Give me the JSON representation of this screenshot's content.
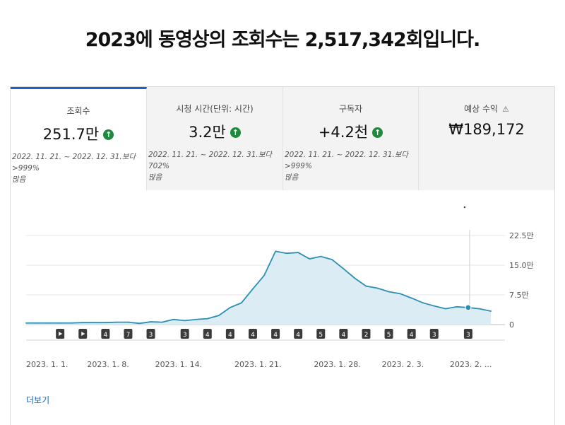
{
  "headline": "2023에 동영상의 조회수는 2,517,342회입니다.",
  "cards": [
    {
      "label": "조회수",
      "value": "251.7만",
      "trend": "up",
      "compare_line1": "2022. 11. 21. ~ 2022. 12. 31.보다 >999%",
      "compare_line2": "많음"
    },
    {
      "label": "시청 시간(단위: 시간)",
      "value": "3.2만",
      "trend": "up",
      "compare_line1": "2022. 11. 21. ~ 2022. 12. 31.보다 702%",
      "compare_line2": "많음"
    },
    {
      "label": "구독자",
      "value": "+4.2천",
      "trend": "up",
      "compare_line1": "2022. 11. 21. ~ 2022. 12. 31.보다 >999%",
      "compare_line2": "많음"
    },
    {
      "label": "예상 수익",
      "value": "₩189,172",
      "trend": "warning",
      "compare_line1": "",
      "compare_line2": ""
    }
  ],
  "chart_data": {
    "type": "area",
    "y_ticks": [
      {
        "value": 0,
        "label": "0"
      },
      {
        "value": 75000,
        "label": "7.5만"
      },
      {
        "value": 150000,
        "label": "15.0만"
      },
      {
        "value": 225000,
        "label": "22.5만"
      }
    ],
    "ylim": [
      0,
      225000
    ],
    "x_tick_labels": [
      "2023. 1. 1.",
      "2023. 1. 8.",
      "2023. 1. 14.",
      "2023. 1. 21.",
      "2023. 1. 28.",
      "2023. 2. 3.",
      "2023. 2. ..."
    ],
    "x_tick_positions": [
      0,
      7,
      13,
      20,
      27,
      33,
      39
    ],
    "x": [
      0,
      1,
      2,
      3,
      4,
      5,
      6,
      7,
      8,
      9,
      10,
      11,
      12,
      13,
      14,
      15,
      16,
      17,
      18,
      19,
      20,
      21,
      22,
      23,
      24,
      25,
      26,
      27,
      28,
      29,
      30,
      31,
      32,
      33,
      34,
      35,
      36,
      37,
      38,
      39,
      40,
      41
    ],
    "series": [
      {
        "name": "",
        "color": "#2a8fb3",
        "fill": "#dcecf5",
        "values": [
          4000,
          4000,
          4000,
          4000,
          4000,
          5000,
          5000,
          5000,
          6000,
          6000,
          3000,
          7000,
          6000,
          13000,
          10000,
          13000,
          15000,
          23000,
          43000,
          55000,
          90000,
          124000,
          185000,
          180000,
          182000,
          166000,
          172000,
          164000,
          141000,
          117000,
          97000,
          92000,
          83000,
          78000,
          67000,
          55000,
          47000,
          40000,
          45000,
          43000,
          40000,
          34000
        ]
      }
    ],
    "highlight_index": 39,
    "markers": [
      {
        "x": 3,
        "kind": "play"
      },
      {
        "x": 5,
        "kind": "play"
      },
      {
        "x": 7,
        "kind": "count",
        "label": "4"
      },
      {
        "x": 9,
        "kind": "count",
        "label": "7"
      },
      {
        "x": 11,
        "kind": "count",
        "label": "3"
      },
      {
        "x": 14,
        "kind": "count",
        "label": "3"
      },
      {
        "x": 16,
        "kind": "count",
        "label": "4"
      },
      {
        "x": 18,
        "kind": "count",
        "label": "4"
      },
      {
        "x": 20,
        "kind": "count",
        "label": "4"
      },
      {
        "x": 22,
        "kind": "count",
        "label": "4"
      },
      {
        "x": 24,
        "kind": "count",
        "label": "4"
      },
      {
        "x": 26,
        "kind": "count",
        "label": "5"
      },
      {
        "x": 28,
        "kind": "count",
        "label": "4"
      },
      {
        "x": 30,
        "kind": "count",
        "label": "2"
      },
      {
        "x": 32,
        "kind": "count",
        "label": "5"
      },
      {
        "x": 34,
        "kind": "count",
        "label": "4"
      },
      {
        "x": 36,
        "kind": "count",
        "label": "3"
      },
      {
        "x": 39,
        "kind": "count",
        "label": "3"
      }
    ],
    "grid": true
  },
  "more_link": "더보기"
}
